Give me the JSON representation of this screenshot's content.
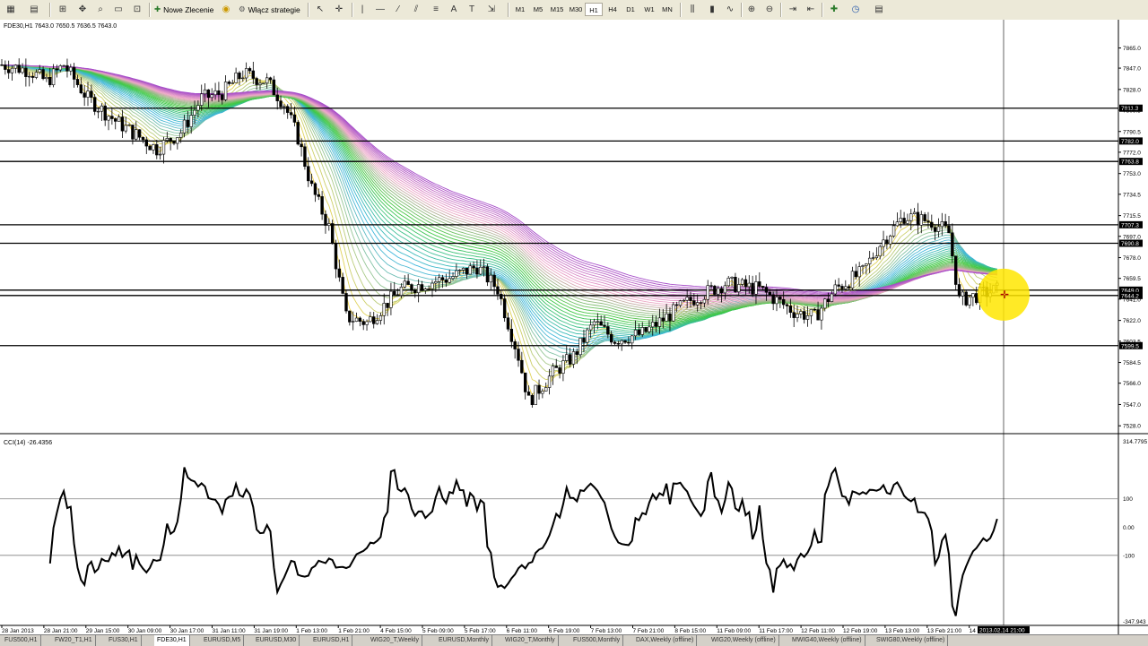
{
  "toolbar": {
    "new_order_label": "Nowe Zlecenie",
    "strategies_label": "Włącz strategie",
    "timeframes": [
      "M1",
      "M5",
      "M15",
      "M30",
      "H1",
      "H4",
      "D1",
      "W1",
      "MN"
    ],
    "active_timeframe": "H1"
  },
  "chart": {
    "info": "FDE30,H1  7643.0 7650.5 7636.5 7643.0",
    "price_ticks": [
      "7865.0",
      "7847.0",
      "7828.0",
      "7809.5",
      "7790.5",
      "7772.0",
      "7753.0",
      "7734.5",
      "7715.5",
      "7697.0",
      "7678.0",
      "7659.5",
      "7641.0",
      "7622.0",
      "7603.5",
      "7584.5",
      "7566.0",
      "7547.0",
      "7528.0"
    ],
    "level_labels": [
      {
        "label": "7811.3",
        "price": 7811.3
      },
      {
        "label": "7782.0",
        "price": 7782.0
      },
      {
        "label": "7763.8",
        "price": 7763.8
      },
      {
        "label": "7707.3",
        "price": 7707.3
      },
      {
        "label": "7690.8",
        "price": 7690.8
      },
      {
        "label": "7649.0",
        "price": 7649.0
      },
      {
        "label": "7644.2",
        "price": 7644.2
      },
      {
        "label": "7599.5",
        "price": 7599.5
      }
    ],
    "price_range": [
      7521,
      7887
    ],
    "time_labels": [
      "28 Jan 2013",
      "28 Jan 21:00",
      "29 Jan 15:00",
      "30 Jan 09:00",
      "30 Jan 17:00",
      "31 Jan 11:00",
      "31 Jan 19:00",
      "1 Feb 13:00",
      "1 Feb 21:00",
      "4 Feb 15:00",
      "5 Feb 09:00",
      "5 Feb 17:00",
      "6 Feb 11:00",
      "6 Feb 19:00",
      "7 Feb 13:00",
      "7 Feb 21:00",
      "8 Feb 15:00",
      "11 Feb 09:00",
      "11 Feb 17:00",
      "12 Feb 11:00",
      "12 Feb 19:00",
      "13 Feb 13:00",
      "13 Feb 21:00",
      "14"
    ],
    "cursor_time_label": "2013.02.14 21:00"
  },
  "indicator": {
    "info": "CCI(14) -26.4356",
    "ticks": [
      "314.7795",
      "100",
      "0.00",
      "-100",
      "-347.943"
    ],
    "range": [
      -347.943,
      314.7795
    ]
  },
  "tabs": [
    "FUS500,H1",
    "FW20_T1,H1",
    "FUS30,H1",
    "FDE30,H1",
    "EURUSD,M5",
    "EURUSD,M30",
    "EURUSD,H1",
    "WIG20_T,Weekly",
    "EURUSD,Monthly",
    "WIG20_T,Monthly",
    "FUS500,Monthly",
    "DAX,Weekly (offline)",
    "WIG20,Weekly (offline)",
    "MWIG40,Weekly (offline)",
    "SWIG80,Weekly (offline)"
  ],
  "active_tab": "FDE30,H1",
  "colors": {
    "bull": "#ffffff",
    "bear": "#000000",
    "highlight": "#ffe600",
    "ribbon_fast": "#f2d54a",
    "ribbon_mid": "#3fb7e0",
    "ribbon_green": "#3ec93e",
    "ribbon_slow": "#a64dc8"
  }
}
